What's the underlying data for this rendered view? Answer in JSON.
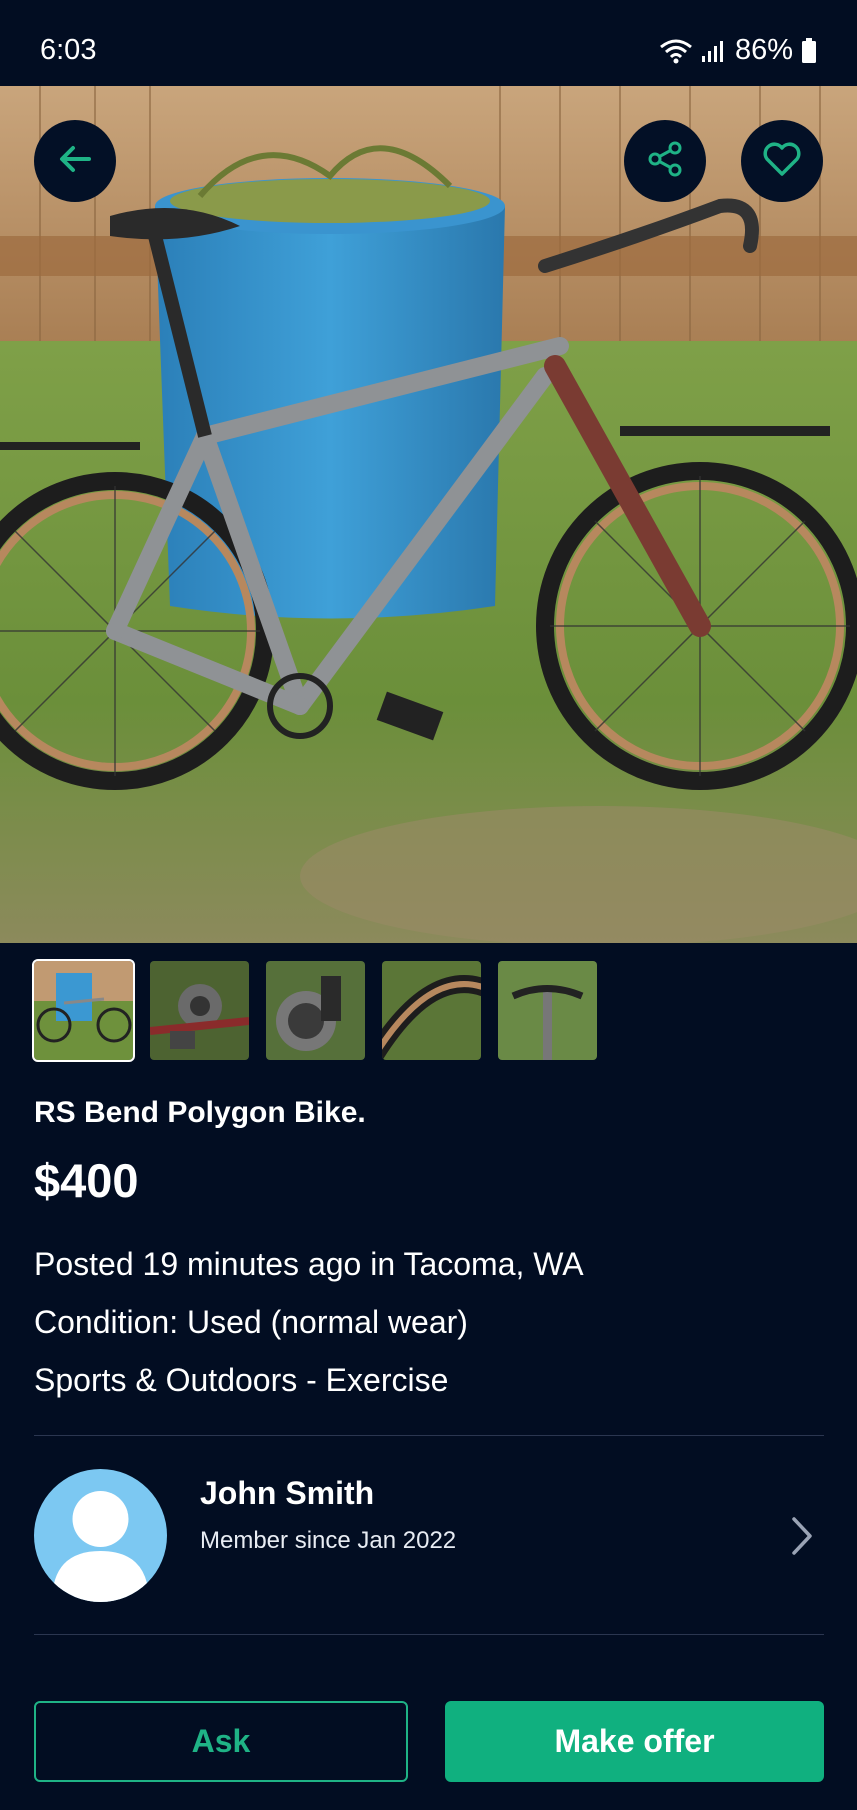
{
  "status_bar": {
    "time": "6:03",
    "battery_percent": "86%",
    "icons": [
      "wifi-icon",
      "signal-icon",
      "battery-icon"
    ]
  },
  "header": {
    "back_icon": "arrow-left-icon",
    "share_icon": "share-icon",
    "favorite_icon": "heart-icon"
  },
  "gallery": {
    "thumbnails": [
      "bike-side-view",
      "rear-derailleur",
      "disc-brake",
      "tire-closeup",
      "handlebar-view"
    ]
  },
  "listing": {
    "title": "RS Bend Polygon Bike.",
    "price": "$400",
    "posted": "Posted 19 minutes ago in Tacoma, WA",
    "condition": "Condition: Used (normal wear)",
    "category": "Sports & Outdoors - Exercise"
  },
  "seller": {
    "name": "John Smith",
    "member_since": "Member since Jan 2022",
    "chevron_icon": "chevron-right-icon"
  },
  "actions": {
    "ask_label": "Ask",
    "offer_label": "Make offer"
  },
  "colors": {
    "background": "#020d22",
    "accent": "#10b07f",
    "avatar": "#7cc8f2"
  }
}
